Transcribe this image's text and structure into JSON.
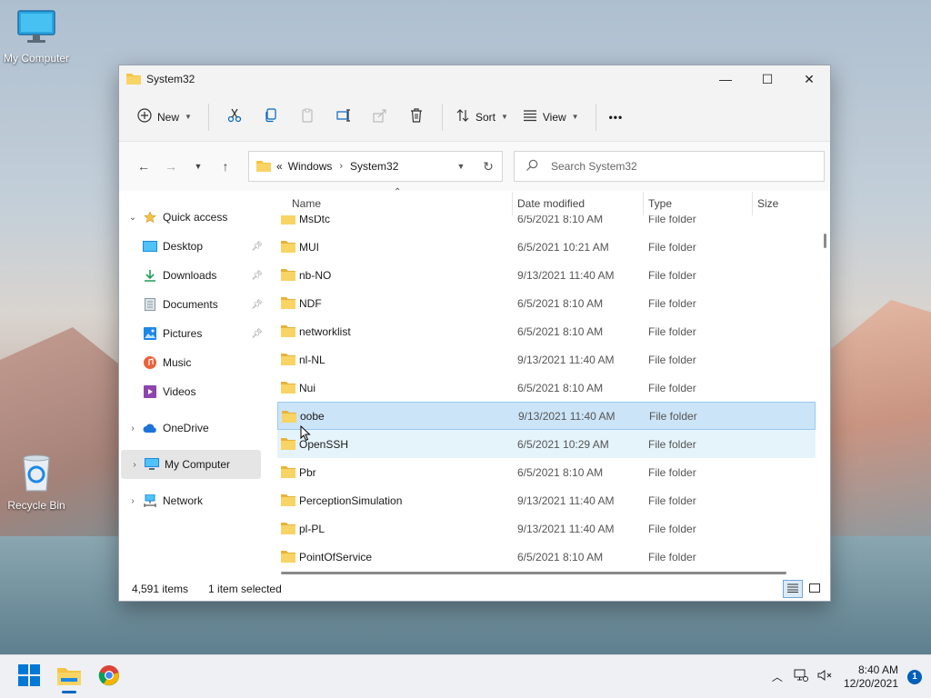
{
  "desktop": {
    "icons": [
      {
        "label": "My Computer"
      },
      {
        "label": "Recycle Bin"
      }
    ]
  },
  "window": {
    "title": "System32",
    "controls": {
      "minimize": "—",
      "maximize": "☐",
      "close": "✕"
    }
  },
  "toolbar": {
    "new_label": "New",
    "sort_label": "Sort",
    "view_label": "View",
    "more_label": "•••"
  },
  "navbar": {
    "breadcrumb": [
      "«",
      "Windows",
      "System32"
    ],
    "search_placeholder": "Search System32"
  },
  "sidebar": {
    "items": [
      {
        "label": "Quick access"
      },
      {
        "label": "Desktop"
      },
      {
        "label": "Downloads"
      },
      {
        "label": "Documents"
      },
      {
        "label": "Pictures"
      },
      {
        "label": "Music"
      },
      {
        "label": "Videos"
      },
      {
        "label": "OneDrive"
      },
      {
        "label": "My Computer"
      },
      {
        "label": "Network"
      }
    ]
  },
  "columns": {
    "name": "Name",
    "date": "Date modified",
    "type": "Type",
    "size": "Size"
  },
  "files": [
    {
      "name": "MsDtc",
      "date": "6/5/2021 8:10 AM",
      "type": "File folder"
    },
    {
      "name": "MUI",
      "date": "6/5/2021 10:21 AM",
      "type": "File folder"
    },
    {
      "name": "nb-NO",
      "date": "9/13/2021 11:40 AM",
      "type": "File folder"
    },
    {
      "name": "NDF",
      "date": "6/5/2021 8:10 AM",
      "type": "File folder"
    },
    {
      "name": "networklist",
      "date": "6/5/2021 8:10 AM",
      "type": "File folder"
    },
    {
      "name": "nl-NL",
      "date": "9/13/2021 11:40 AM",
      "type": "File folder"
    },
    {
      "name": "Nui",
      "date": "6/5/2021 8:10 AM",
      "type": "File folder"
    },
    {
      "name": "oobe",
      "date": "9/13/2021 11:40 AM",
      "type": "File folder"
    },
    {
      "name": "OpenSSH",
      "date": "6/5/2021 10:29 AM",
      "type": "File folder"
    },
    {
      "name": "Pbr",
      "date": "6/5/2021 8:10 AM",
      "type": "File folder"
    },
    {
      "name": "PerceptionSimulation",
      "date": "9/13/2021 11:40 AM",
      "type": "File folder"
    },
    {
      "name": "pl-PL",
      "date": "9/13/2021 11:40 AM",
      "type": "File folder"
    },
    {
      "name": "PointOfService",
      "date": "6/5/2021 8:10 AM",
      "type": "File folder"
    }
  ],
  "status": {
    "count": "4,591 items",
    "selection": "1 item selected"
  },
  "taskbar": {
    "time": "8:40 AM",
    "date": "12/20/2021",
    "notifications": "1"
  },
  "colors": {
    "accent": "#0067c0",
    "selection": "#cce4f7",
    "folder": "#f4c542"
  }
}
